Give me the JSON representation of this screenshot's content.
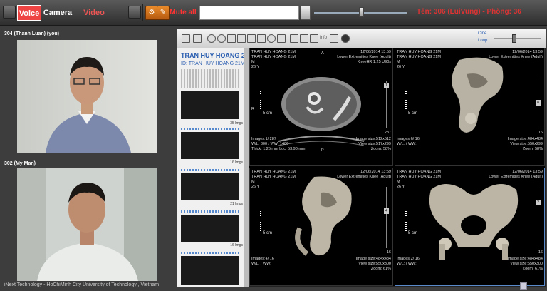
{
  "topbar": {
    "voice_label": "Voice",
    "camera_label": "Camera",
    "video_label": "Video",
    "mute_label": "Mute all",
    "room_label": "Tên: 306 (LuiVung) - Phòng: 36"
  },
  "videos": [
    {
      "title": "304 (Thanh Luan) (you)"
    },
    {
      "title": "302 (My Man)"
    }
  ],
  "footer": "iNext Technology - HoChiMinh City University of Technology , Vietnam",
  "toolbar": {
    "info_label": "Info",
    "cine_label": "Cine",
    "loop_label": "Loop"
  },
  "patient": {
    "name": "TRAN HUY HOANG 21M",
    "id": "ID: TRAN HUY HOANG 21M",
    "series": [
      {
        "count": "35 Imgs"
      },
      {
        "count": "16 Imgs"
      },
      {
        "count": "21 Imgs"
      },
      {
        "count": "16 Imgs"
      }
    ]
  },
  "panes": [
    {
      "name": "TRAN HUY HOANG 21M",
      "lines_left": [
        "TRAN HUY HOANG 21M",
        "M",
        "26 Y"
      ],
      "date": "12/06/2014 13:59",
      "study": "Lower Extremities Knee (Adult)",
      "extra": "KneeHR 1.25 U90s",
      "marker_a": "A",
      "marker_r": "R",
      "marker_p": "P",
      "scale_label": "5 cm",
      "right_num": "1",
      "bottom_left": [
        "Images:1/ 287",
        "W/L: 300 / WW: 1400",
        "Thick: 1.25 mm  Loc: 53.90 mm"
      ],
      "bottom_right": [
        "Image size:512x512",
        "View size:517x299",
        "Zoom: 58%"
      ],
      "count": "287"
    },
    {
      "name": "TRAN HUY HOANG 21M",
      "lines_left": [
        "TRAN HUY HOANG 21M",
        "M",
        "26 Y"
      ],
      "date": "12/06/2014 13:59",
      "study": "Lower Extremities Knee (Adult)",
      "scale_label": "5 cm",
      "right_num": "8",
      "bottom_left": [
        "Images:6/ 16",
        "W/L: / WW:"
      ],
      "bottom_right": [
        "Image size:484x484",
        "View size:550x299",
        "Zoom: 58%"
      ],
      "count": "16"
    },
    {
      "name": "TRAN HUY HOANG 21M",
      "lines_left": [
        "TRAN HUY HOANG 21M",
        "M",
        "26 Y"
      ],
      "date": "12/06/2014 13:59",
      "study": "Lower Extremities Knee (Adult)",
      "scale_label": "5 cm",
      "right_num": "4",
      "bottom_left": [
        "Images:4/ 16",
        "W/L: / WW:"
      ],
      "bottom_right": [
        "Image size:484x484",
        "View size:550x300",
        "Zoom: 61%"
      ],
      "count": "16"
    },
    {
      "name": "TRAN HUY HOANG 21M",
      "lines_left": [
        "TRAN HUY HOANG 21M",
        "M",
        "26 Y"
      ],
      "date": "12/06/2014 13:59",
      "study": "Lower Extremities Knee (Adult)",
      "scale_label": "5 cm",
      "right_num": "2",
      "bottom_left": [
        "Images:2/ 16",
        "W/L: / WW:"
      ],
      "bottom_right": [
        "Image size:484x484",
        "View size:550x300",
        "Zoom: 61%"
      ],
      "count": "16"
    }
  ]
}
